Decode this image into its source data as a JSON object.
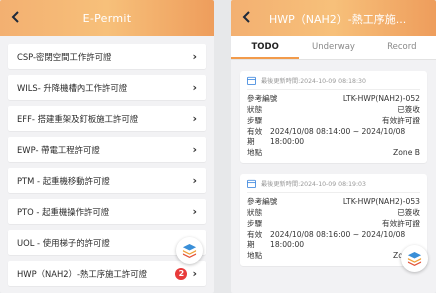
{
  "left": {
    "title": "E-Permit",
    "back_icon": "chevron-left-icon",
    "items": [
      {
        "label": "CSP-密閉空間工作許可證"
      },
      {
        "label": "WILS- 升降機槽內工作許可證"
      },
      {
        "label": "EFF- 搭建重架及釘板施工許可證"
      },
      {
        "label": "EWP- 帶電工程許可證"
      },
      {
        "label": "PTM - 起重機移動許可證"
      },
      {
        "label": "PTO - 起重機操作許可證"
      },
      {
        "label": "UOL - 使用梯子的許可證"
      },
      {
        "label": "HWP（NAH2）-熱工序施工許可證",
        "badge": "2"
      }
    ],
    "fab_icon": "stack-layers-icon"
  },
  "right": {
    "title": "HWP（NAH2）-熱工序施...",
    "back_icon": "chevron-left-icon",
    "tabs": [
      {
        "label": "TODO",
        "active": true
      },
      {
        "label": "Underway",
        "active": false
      },
      {
        "label": "Record",
        "active": false
      }
    ],
    "cards": [
      {
        "updated": "最後更新時間:2024-10-09 08:18:30",
        "ref_label": "參考編號",
        "ref_value": "LTK-HWP(NAH2)-052",
        "status_label": "狀態",
        "status_value": "已簽收",
        "step_label": "步驟",
        "step_value": "有效許可證",
        "period_label": "有效期",
        "period_value": "2024/10/08 08:14:00 ~ 2024/10/08 18:00:00",
        "loc_label": "地點",
        "loc_value": "Zone B"
      },
      {
        "updated": "最後更新時間:2024-10-09 08:19:03",
        "ref_label": "參考編號",
        "ref_value": "LTK-HWP(NAH2)-053",
        "status_label": "狀態",
        "status_value": "已簽收",
        "step_label": "步驟",
        "step_value": "有效許可證",
        "period_label": "有效期",
        "period_value": "2024/10/08 08:16:00 ~ 2024/10/08 18:00:00",
        "loc_label": "地點",
        "loc_value": "Zone B"
      }
    ],
    "fab_icon": "stack-layers-icon"
  },
  "colors": {
    "header_gradient_start": "#f3b071",
    "header_gradient_end": "#ee9d5c",
    "tab_indicator": "#f29b4b",
    "badge": "#e83a3a"
  }
}
